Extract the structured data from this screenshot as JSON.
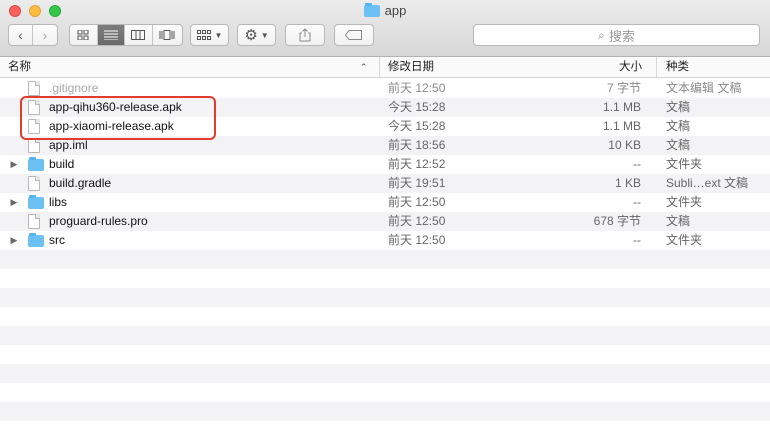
{
  "window": {
    "title": "app"
  },
  "toolbar": {
    "back_icon": "chevron-left-icon",
    "forward_icon": "chevron-right-icon",
    "search_placeholder": "搜索"
  },
  "columns": {
    "name": "名称",
    "date": "修改日期",
    "size": "大小",
    "kind": "种类"
  },
  "files": [
    {
      "name": ".gitignore",
      "date": "前天 12:50",
      "size": "7 字节",
      "kind": "文本编辑 文稿",
      "type": "file",
      "dim": true
    },
    {
      "name": "app-qihu360-release.apk",
      "date": "今天 15:28",
      "size": "1.1 MB",
      "kind": "文稿",
      "type": "file"
    },
    {
      "name": "app-xiaomi-release.apk",
      "date": "今天 15:28",
      "size": "1.1 MB",
      "kind": "文稿",
      "type": "file"
    },
    {
      "name": "app.iml",
      "date": "前天 18:56",
      "size": "10 KB",
      "kind": "文稿",
      "type": "file"
    },
    {
      "name": "build",
      "date": "前天 12:52",
      "size": "--",
      "kind": "文件夹",
      "type": "folder"
    },
    {
      "name": "build.gradle",
      "date": "前天 19:51",
      "size": "1 KB",
      "kind": "Subli…ext 文稿",
      "type": "file"
    },
    {
      "name": "libs",
      "date": "前天 12:50",
      "size": "--",
      "kind": "文件夹",
      "type": "folder"
    },
    {
      "name": "proguard-rules.pro",
      "date": "前天 12:50",
      "size": "678 字节",
      "kind": "文稿",
      "type": "file"
    },
    {
      "name": "src",
      "date": "前天 12:50",
      "size": "--",
      "kind": "文件夹",
      "type": "folder"
    }
  ],
  "colors": {
    "highlight": "#e43b2f",
    "folder": "#6cc0f4"
  }
}
